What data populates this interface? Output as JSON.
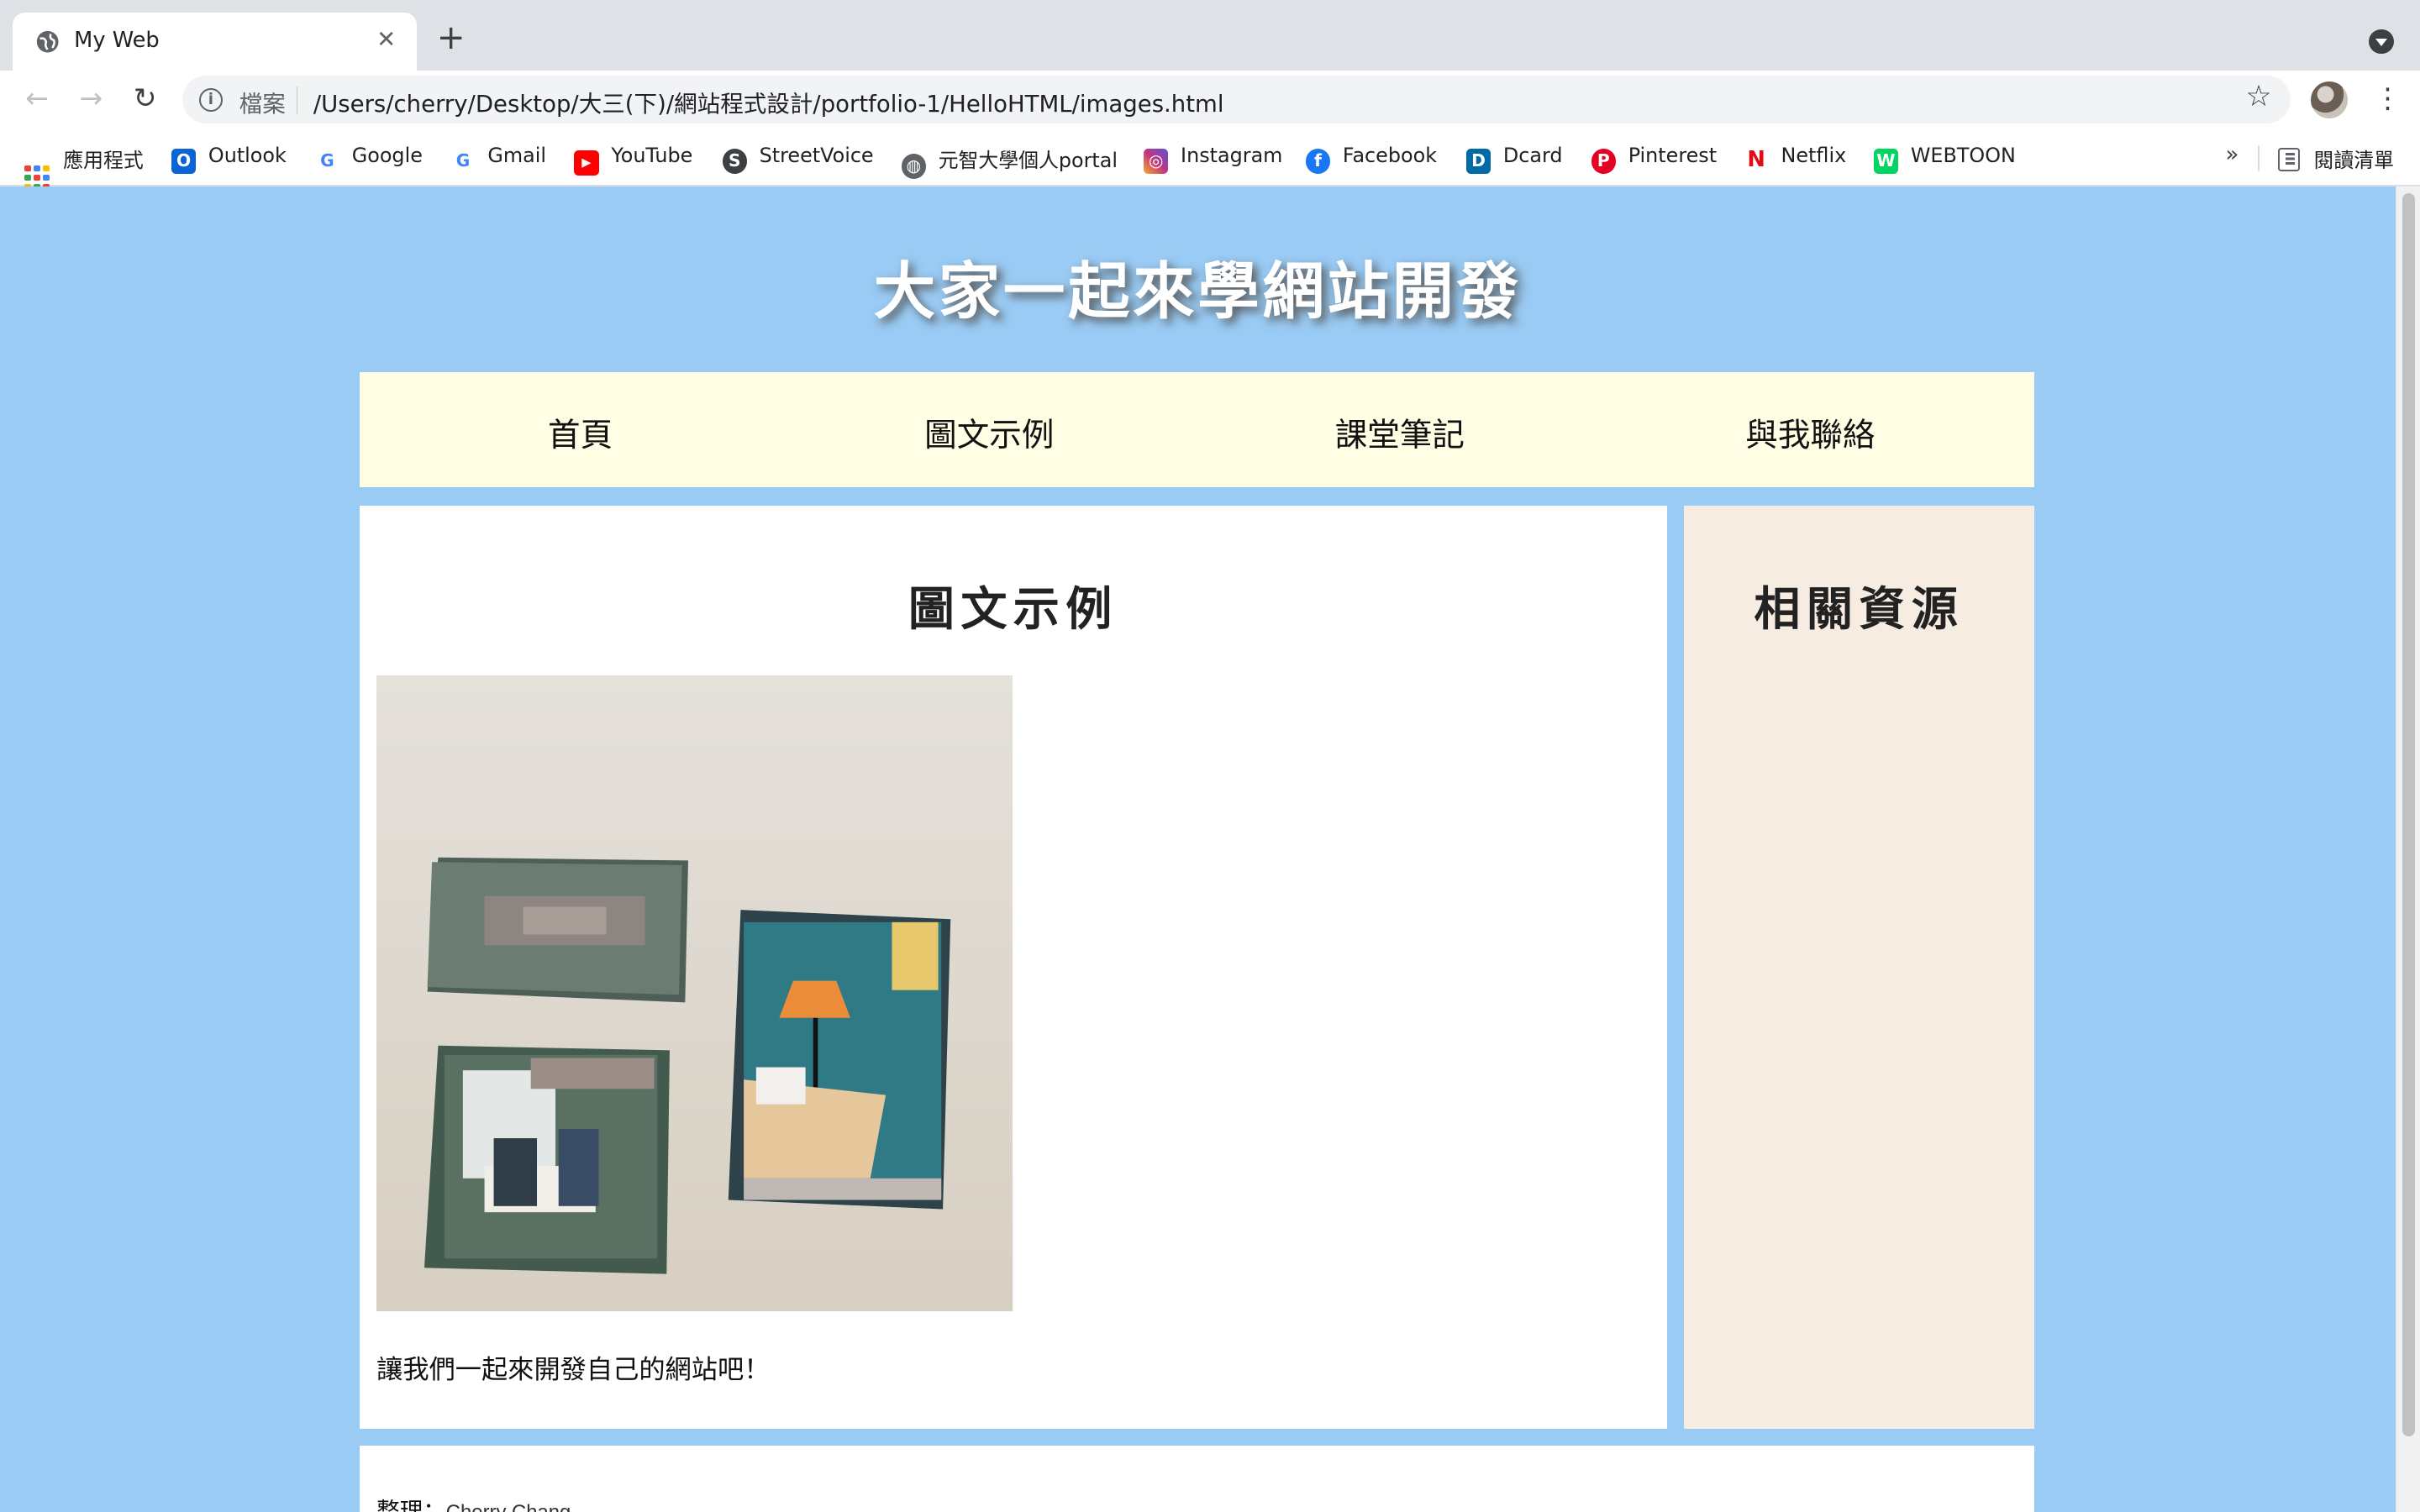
{
  "browser": {
    "tab_title": "My Web",
    "tab_close": "✕",
    "new_tab": "+",
    "back": "←",
    "forward": "→",
    "reload": "↻",
    "info": "i",
    "scheme_label": "檔案",
    "url": "/Users/cherry/Desktop/大三(下)/網站程式設計/portfolio-1/HelloHTML/images.html",
    "star": "☆",
    "menu": "⋮",
    "bookmarks_more": "»",
    "reading_list": "閱讀清單"
  },
  "bookmarks": [
    {
      "label": "應用程式",
      "icon": "apps-grid-icon"
    },
    {
      "label": "Outlook",
      "icon": "outlook-icon",
      "color": "#0a64d6",
      "glyph": "O"
    },
    {
      "label": "Google",
      "icon": "google-icon",
      "color": "#4285f4",
      "glyph": "G"
    },
    {
      "label": "Gmail",
      "icon": "google-icon",
      "color": "#4285f4",
      "glyph": "G"
    },
    {
      "label": "YouTube",
      "icon": "youtube-icon",
      "color": "#ff0000",
      "glyph": "▶"
    },
    {
      "label": "StreetVoice",
      "icon": "streetvoice-icon",
      "color": "#3c4043",
      "glyph": "S"
    },
    {
      "label": "元智大學個人portal",
      "icon": "globe-icon",
      "color": "#5f6368",
      "glyph": "◍"
    },
    {
      "label": "Instagram",
      "icon": "instagram-icon",
      "color": "#c13584",
      "glyph": "◎"
    },
    {
      "label": "Facebook",
      "icon": "facebook-icon",
      "color": "#1877f2",
      "glyph": "f"
    },
    {
      "label": "Dcard",
      "icon": "dcard-icon",
      "color": "#006aa6",
      "glyph": "D"
    },
    {
      "label": "Pinterest",
      "icon": "pinterest-icon",
      "color": "#e60023",
      "glyph": "P"
    },
    {
      "label": "Netflix",
      "icon": "netflix-icon",
      "color": "#e50914",
      "glyph": "N"
    },
    {
      "label": "WEBTOON",
      "icon": "webtoon-icon",
      "color": "#00d564",
      "glyph": "W"
    }
  ],
  "page": {
    "site_title": "大家一起來學網站開發",
    "nav": [
      "首頁",
      "圖文示例",
      "課堂筆記",
      "與我聯絡"
    ],
    "main_heading": "圖文示例",
    "caption": "讓我們一起來開發自己的網站吧！",
    "sidebar_heading": "相關資源",
    "footer_label": "整理：",
    "footer_name": "Cherry Chang"
  },
  "colors": {
    "page_bg": "#99cbf4",
    "nav_bg": "#fffde4",
    "sidebar_bg": "#f6ece2"
  }
}
